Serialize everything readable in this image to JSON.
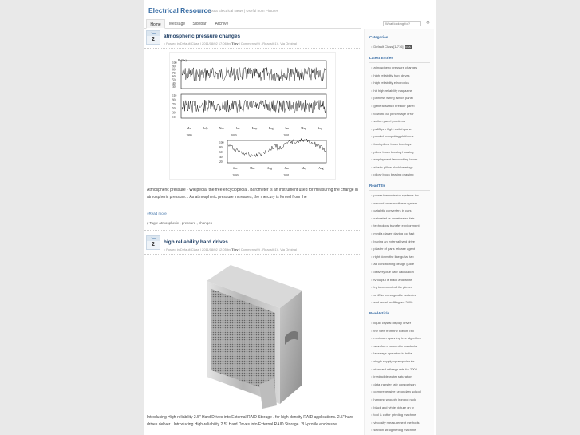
{
  "header": {
    "title": "Electrical Resource",
    "description": "About Electrical News | Useful from Pictures"
  },
  "nav": {
    "items": [
      "Home",
      "Message",
      "Sidebar",
      "Archive"
    ]
  },
  "search": {
    "placeholder": "What looking for?"
  },
  "posts": [
    {
      "month": "Jan",
      "day": "2",
      "title": "atmospheric pressure changes",
      "meta_prefix": "Posted in Default Class | 2011/08/02 17:06 by",
      "author": "Tiny",
      "meta_suffix": "| Comments(0) , Reads(61) , Via Original",
      "text": "Atmospheric pressure - Wikipedia, the free encyclopedia . Barometer is an instrument used for measuring the change in atmospheric pressure. . As atmospheric pressure increases, the mercury is forced from the",
      "read_more": "Read more",
      "tags": "Tags: atmospheric , pressure , changes"
    },
    {
      "month": "Jan",
      "day": "2",
      "title": "high reliability hard drives",
      "meta_prefix": "Posted in Default Class | 2011/08/02 12:05 by",
      "author": "Tiny",
      "meta_suffix": "| Comments(0) , Reads(61) , Via Original",
      "text": "Introducing High-reliability 2.5\" Hard Drives into External RAID Storage . for high density RAID applications. 2.5\" hard drives deliver . Introducing High-reliability 2.5\" Hard Drives into External RAID Storage. 2U-profile enclosure ."
    }
  ],
  "figure": {
    "panel1_label": "Pa(Pa)",
    "panel1_ticks": [
      "100",
      "90",
      "80",
      "70",
      "60",
      "50",
      "40",
      "30"
    ],
    "panel2_ticks": [
      "110",
      "90",
      "70",
      "50",
      "30",
      "10"
    ],
    "months_top": [
      "Mar",
      "July",
      "Nov",
      "Jan.",
      "May",
      "Aug",
      "Jan.",
      "May",
      "Aug"
    ],
    "years_top": [
      "1999",
      "2000",
      "2001"
    ],
    "panel3_ticks": [
      "100",
      "80",
      "60",
      "40",
      "20"
    ],
    "months_bottom": [
      "Jan.",
      "May",
      "Aug",
      "Jan.",
      "May",
      "Aug"
    ],
    "years_bottom": [
      "2000",
      "2001"
    ]
  },
  "sidebar": {
    "categories_heading": "Categories",
    "categories": [
      "Default Class [1/716]"
    ],
    "rss_badge": "RSS",
    "latest_heading": "Latest Entries",
    "latest": [
      "atmospheric pressure changes",
      "high reliability hard drives",
      "high reliability electronics",
      "hb high reliability magazine",
      "painless wiring switch panel",
      "general switch breaker panel",
      "to work out percentage error",
      "switch panel problems",
      "pz65 pro flight switch panel",
      "parallel computing platforms",
      "fafnir pillow block bearings",
      "pillow block bearing housing",
      "employment law working hours",
      "elastic pillow block bearings",
      "pillow block bearing drawing"
    ],
    "read_title_heading": "ReadTitle",
    "read_title": [
      "power transmission systems inc",
      "second order nonlinear system",
      "catalytic converters in cars",
      "saturated or unsaturated fats",
      "technology transfer environment",
      "media player playing too fast",
      "buying an external hard drive",
      "plaster of paris release agent",
      "right down the line guitar tab",
      "air conditioning design guide",
      "delivery due date calculation",
      "tv output is black and white",
      "try to connect all the pieces",
      "cr123a rechargeable batteries",
      "end racial profiling act 2009"
    ],
    "read_article_heading": "ReadArticle",
    "read_article": [
      "liquid crystal display driver",
      "the view from the bottom rail",
      "minimum spanning tree algorithm",
      "waveform concentric conductor",
      "laser eye operation in india",
      "single supply op amp circuits",
      "standard mileage rate for 2008",
      "irreducible water saturation",
      "data transfer rate comparison",
      "comprehensive secondary school",
      "hanging wrought iron pot rack",
      "black and white picture on tv",
      "tool & cutter grinding machine",
      "viscosity measurement methods",
      "section straightening machine"
    ]
  }
}
